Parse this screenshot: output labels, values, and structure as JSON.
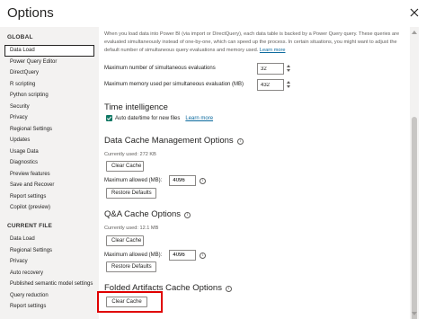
{
  "window": {
    "title": "Options"
  },
  "sidebar": {
    "global_header": "GLOBAL",
    "global_items": [
      {
        "label": "Data Load",
        "selected": true
      },
      {
        "label": "Power Query Editor"
      },
      {
        "label": "DirectQuery"
      },
      {
        "label": "R scripting"
      },
      {
        "label": "Python scripting"
      },
      {
        "label": "Security"
      },
      {
        "label": "Privacy"
      },
      {
        "label": "Regional Settings"
      },
      {
        "label": "Updates"
      },
      {
        "label": "Usage Data"
      },
      {
        "label": "Diagnostics"
      },
      {
        "label": "Preview features"
      },
      {
        "label": "Save and Recover"
      },
      {
        "label": "Report settings"
      },
      {
        "label": "Copilot (preview)"
      }
    ],
    "file_header": "CURRENT FILE",
    "file_items": [
      {
        "label": "Data Load"
      },
      {
        "label": "Regional Settings"
      },
      {
        "label": "Privacy"
      },
      {
        "label": "Auto recovery"
      },
      {
        "label": "Published semantic model settings"
      },
      {
        "label": "Query reduction"
      },
      {
        "label": "Report settings"
      }
    ]
  },
  "content": {
    "intro_text": "When you load data into Power BI (via import or DirectQuery), each data table is backed by a Power Query query. These queries are evaluated simultaneously instead of one-by-one, which can speed up the process. In certain situations, you might want to adjust the default number of simultaneous query evaluations and memory used.",
    "intro_link": "Learn more",
    "max_evaluations_label": "Maximum number of simultaneous evaluations",
    "max_evaluations_value": "32",
    "max_memory_label": "Maximum memory used per simultaneous evaluation (MB)",
    "max_memory_value": "432",
    "time_intelligence": {
      "title": "Time intelligence",
      "checkbox_label": "Auto date/time for new files",
      "checked": true,
      "link": "Learn more"
    },
    "data_cache": {
      "title": "Data Cache Management Options",
      "currently_used": "Currently used: 272 KB",
      "clear_label": "Clear Cache",
      "max_allowed_label": "Maximum allowed (MB):",
      "max_allowed_value": "4096",
      "restore_label": "Restore Defaults"
    },
    "qa_cache": {
      "title": "Q&A Cache Options",
      "currently_used": "Currently used: 12.1 MB",
      "clear_label": "Clear Cache",
      "max_allowed_label": "Maximum allowed (MB):",
      "max_allowed_value": "4096",
      "restore_label": "Restore Defaults"
    },
    "folded_cache": {
      "title": "Folded Artifacts Cache Options",
      "clear_label": "Clear Cache"
    }
  },
  "icons": {
    "info": "i",
    "close": "close-icon"
  },
  "colors": {
    "checkbox": "#117865",
    "link": "#0b6a9e",
    "highlight": "#e00000"
  }
}
